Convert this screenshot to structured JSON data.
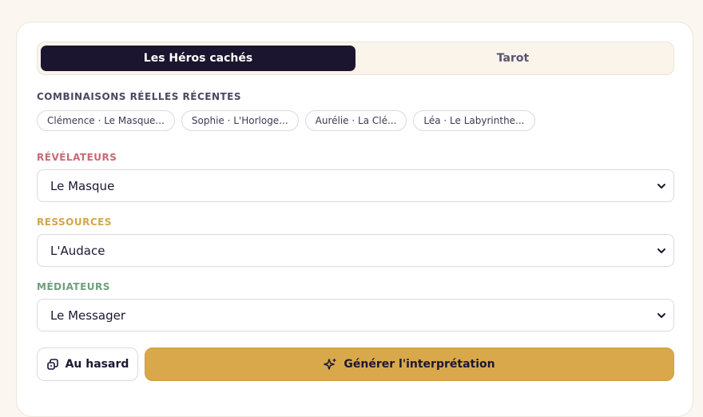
{
  "tabs": [
    {
      "label": "Les Héros cachés",
      "active": true
    },
    {
      "label": "Tarot",
      "active": false
    }
  ],
  "recent": {
    "label": "COMBINAISONS RÉELLES RÉCENTES",
    "chips": [
      "Clémence · Le Masque...",
      "Sophie · L'Horloge...",
      "Aurélie · La Clé...",
      "Léa · Le Labyrinthe..."
    ]
  },
  "revelateurs": {
    "label": "RÉVÉLATEURS",
    "value": "Le Masque",
    "color": "#c96a75"
  },
  "ressources": {
    "label": "RESSOURCES",
    "value": "L'Audace",
    "color": "#d3a54b"
  },
  "mediateurs": {
    "label": "MÉDIATEURS",
    "value": "Le Messager",
    "color": "#6f9e7d"
  },
  "actions": {
    "random_label": "Au hasard",
    "random_icon": "dice-icon",
    "generate_label": "Générer l'interprétation",
    "generate_icon": "sparkles-icon"
  }
}
